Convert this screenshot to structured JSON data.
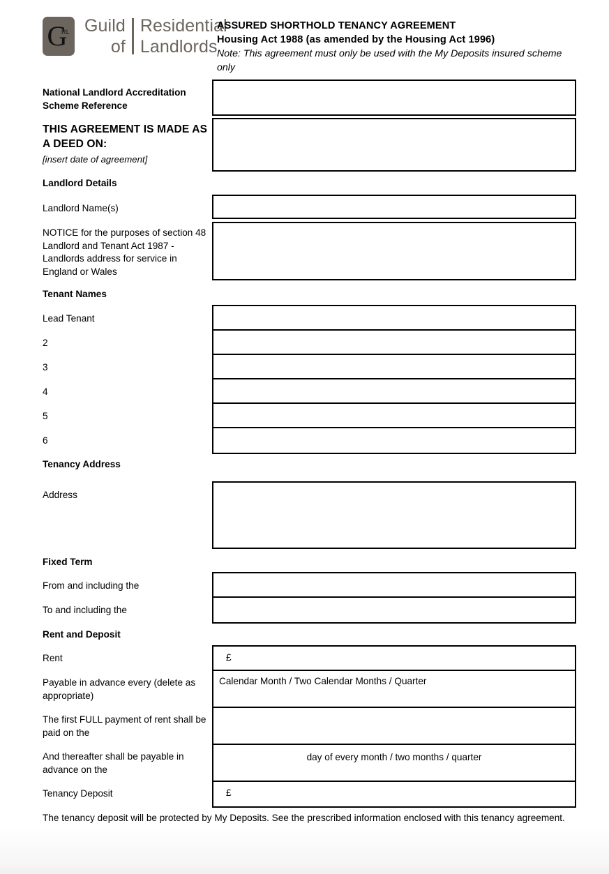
{
  "brand": {
    "mark_letter": "G",
    "mark_sub": "RL",
    "line1_left": "Guild",
    "line2_left": "of",
    "line1_right": "Residential",
    "line2_right": "Landlords",
    "color": "#6b655d"
  },
  "document_header": {
    "title": "ASSURED SHORTHOLD TENANCY AGREEMENT",
    "subtitle": "Housing Act 1988 (as amended by the Housing Act 1996)",
    "note": "Note: This agreement must only be used with the My Deposits insured scheme only"
  },
  "fields": {
    "nlas_label": "National Landlord Accreditation Scheme Reference",
    "deed_label": "THIS AGREEMENT IS MADE AS A DEED ON:",
    "deed_hint": "[insert date of agreement]",
    "landlord_details_heading": "Landlord Details",
    "landlord_names_label": "Landlord Name(s)",
    "notice_label": "NOTICE for the purposes of section 48 Landlord and Tenant Act 1987 - Landlords address for service in England or Wales",
    "tenant_names_heading": "Tenant Names",
    "tenant_rows": [
      "Lead Tenant",
      "2",
      "3",
      "4",
      "5",
      "6"
    ],
    "tenancy_address_heading": "Tenancy Address",
    "address_label": "Address",
    "fixed_term_heading": "Fixed Term",
    "from_label": "From and including the",
    "to_label": "To and including the",
    "rent_deposit_heading": "Rent and Deposit",
    "rent_label": "Rent",
    "rent_value": "£",
    "payable_label": "Payable in advance every (delete as appropriate)",
    "payable_value": "Calendar Month / Two Calendar Months / Quarter",
    "first_full_label": "The first FULL payment of rent shall be paid on the",
    "first_full_value": "",
    "thereafter_label": "And thereafter shall be payable in advance on the",
    "thereafter_value": "day of every month / two months / quarter",
    "deposit_label": "Tenancy Deposit",
    "deposit_value": "£"
  },
  "footnote": "The tenancy deposit will be protected by My Deposits. See the prescribed information enclosed with this tenancy agreement."
}
